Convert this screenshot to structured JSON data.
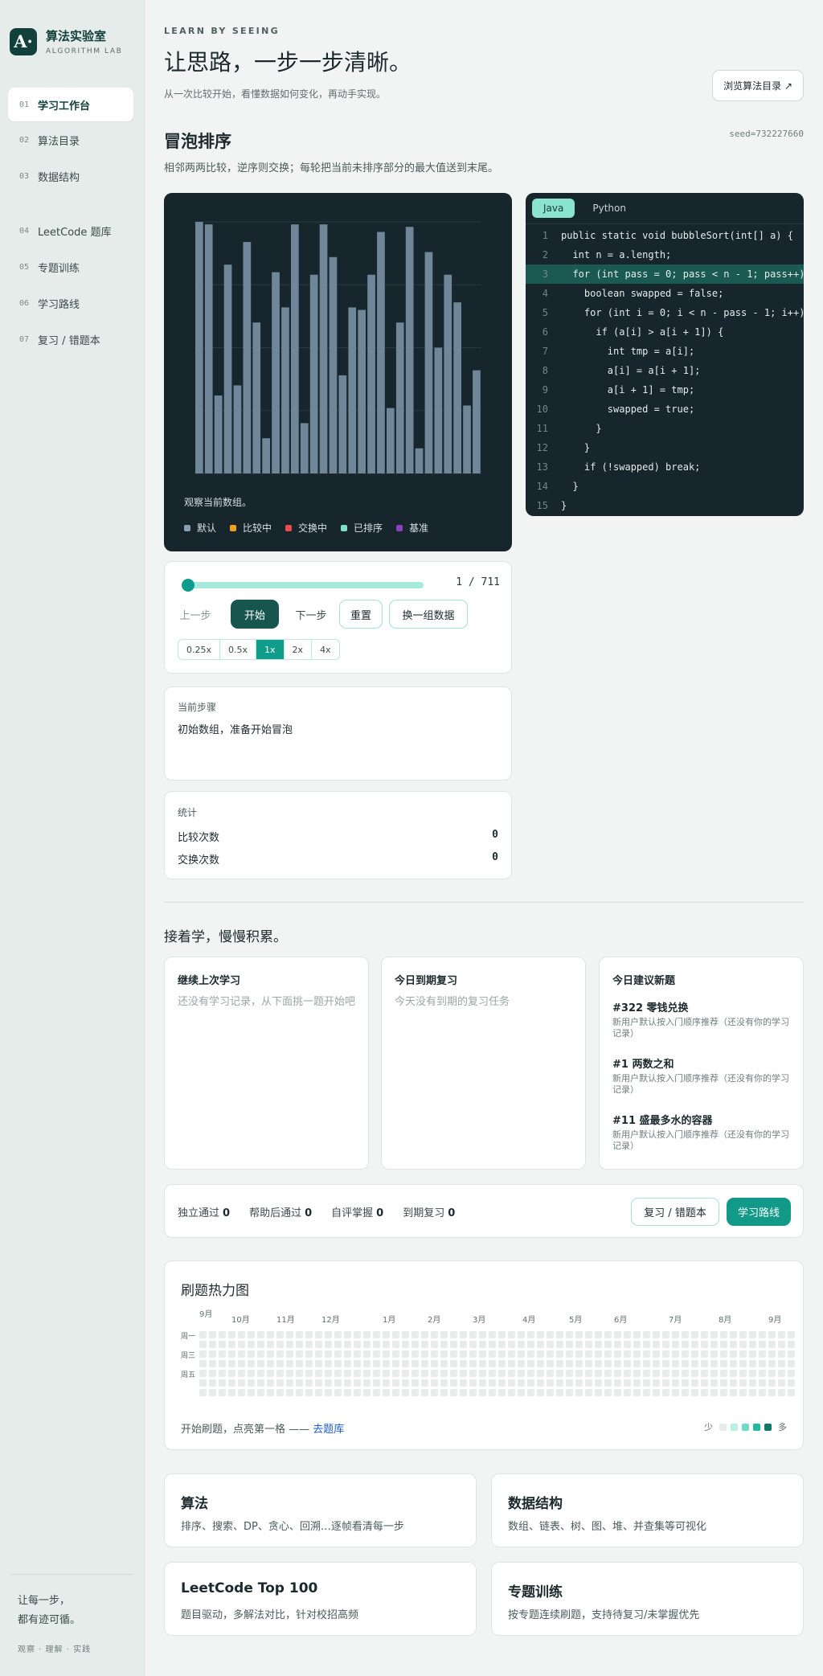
{
  "brand": {
    "logo": "A·",
    "name": "算法实验室",
    "sub": "ALGORITHM LAB"
  },
  "nav": [
    {
      "num": "01",
      "label": "学习工作台",
      "active": true
    },
    {
      "num": "02",
      "label": "算法目录"
    },
    {
      "num": "03",
      "label": "数据结构"
    },
    {
      "num": "04",
      "label": "LeetCode 题库"
    },
    {
      "num": "05",
      "label": "专题训练"
    },
    {
      "num": "06",
      "label": "学习路线"
    },
    {
      "num": "07",
      "label": "复习 / 错题本"
    }
  ],
  "sidebar_footer": {
    "line1": "让每一步，",
    "line2": "都有迹可循。",
    "sub": "观察 · 理解 · 实践"
  },
  "header": {
    "kicker": "LEARN BY SEEING",
    "title": "让思路，一步一步清晰。",
    "subtitle": "从一次比较开始，看懂数据如何变化，再动手实现。",
    "browse": "浏览算法目录 ↗"
  },
  "algorithm": {
    "title": "冒泡排序",
    "seed": "seed=732227660",
    "desc": "相邻两两比较，逆序则交换；每轮把当前未排序部分的最大值送到末尾。"
  },
  "visual": {
    "note": "观察当前数组。",
    "bar_color": "#6f8799",
    "values": [
      100,
      99,
      31,
      83,
      35,
      92,
      60,
      14,
      80,
      66,
      99,
      20,
      79,
      99,
      86,
      39,
      66,
      65,
      79,
      96,
      26,
      60,
      98,
      10,
      88,
      50,
      79,
      68,
      27,
      41
    ]
  },
  "legend": [
    {
      "label": "默认",
      "color": "#8aa0b2"
    },
    {
      "label": "比较中",
      "color": "#f0a020"
    },
    {
      "label": "交换中",
      "color": "#ee4b4b"
    },
    {
      "label": "已排序",
      "color": "#7fe0c8"
    },
    {
      "label": "基准",
      "color": "#8e3fbf"
    }
  ],
  "code": {
    "tabs": [
      "Java",
      "Python"
    ],
    "active_tab": "Java",
    "highlight_line": 3,
    "lines": [
      "public static void bubbleSort(int[] a) {",
      "  int n = a.length;",
      "  for (int pass = 0; pass < n - 1; pass++) {",
      "    boolean swapped = false;",
      "    for (int i = 0; i < n - pass - 1; i++) {",
      "      if (a[i] > a[i + 1]) {",
      "        int tmp = a[i];",
      "        a[i] = a[i + 1];",
      "        a[i + 1] = tmp;",
      "        swapped = true;",
      "      }",
      "    }",
      "    if (!swapped) break;",
      "  }",
      "}"
    ]
  },
  "controls": {
    "progress": "1 / 711",
    "progress_fraction": 0.0014,
    "prev": "上一步",
    "start": "开始",
    "next": "下一步",
    "reset": "重置",
    "shuffle": "换一组数据",
    "speeds": [
      "0.25x",
      "0.5x",
      "1x",
      "2x",
      "4x"
    ],
    "active_speed": "1x"
  },
  "step": {
    "label": "当前步骤",
    "text": "初始数组，准备开始冒泡"
  },
  "stats": {
    "title": "统计",
    "compare_label": "比较次数",
    "compare_value": "0",
    "swap_label": "交换次数",
    "swap_value": "0"
  },
  "learn": {
    "title": "接着学，慢慢积累。",
    "continue": {
      "title": "继续上次学习",
      "empty": "还没有学习记录，从下面挑一题开始吧"
    },
    "due": {
      "title": "今日到期复习",
      "empty": "今天没有到期的复习任务"
    },
    "suggest": {
      "title": "今日建议新题",
      "items": [
        {
          "title": "#322 零钱兑换",
          "desc": "新用户默认按入门顺序推荐（还没有你的学习记录）"
        },
        {
          "title": "#1 两数之和",
          "desc": "新用户默认按入门顺序推荐（还没有你的学习记录）"
        },
        {
          "title": "#11 盛最多水的容器",
          "desc": "新用户默认按入门顺序推荐（还没有你的学习记录）"
        }
      ]
    }
  },
  "summary": {
    "independent_label": "独立通过",
    "independent": "0",
    "helped_label": "帮助后通过",
    "helped": "0",
    "self_label": "自评掌握",
    "self": "0",
    "due_label": "到期复习",
    "due": "0",
    "review_btn": "复习 / 错题本",
    "path_btn": "学习路线"
  },
  "heatmap": {
    "title": "刷题热力图",
    "months": [
      "9月",
      "10月",
      "11月",
      "12月",
      "1月",
      "2月",
      "3月",
      "4月",
      "5月",
      "6月",
      "7月",
      "8月",
      "9月"
    ],
    "days": [
      "周一",
      "周三",
      "周五"
    ],
    "weeks": 62,
    "empty_color": "#e7ebea",
    "foot_text": "开始刷题，点亮第一格 —— ",
    "foot_link": "去题库",
    "scale_less": "少",
    "scale_more": "多",
    "scale_colors": [
      "#e7ebea",
      "#b9efe2",
      "#6fdcc8",
      "#23b8a0",
      "#0f7a6c"
    ]
  },
  "categories": [
    {
      "title": "算法",
      "desc": "排序、搜索、DP、贪心、回溯…逐帧看清每一步"
    },
    {
      "title": "数据结构",
      "desc": "数组、链表、树、图、堆、并查集等可视化"
    },
    {
      "title": "LeetCode Top 100",
      "desc": "题目驱动，多解法对比，针对校招高频"
    },
    {
      "title": "专题训练",
      "desc": "按专题连续刷题，支持待复习/未掌握优先"
    }
  ]
}
